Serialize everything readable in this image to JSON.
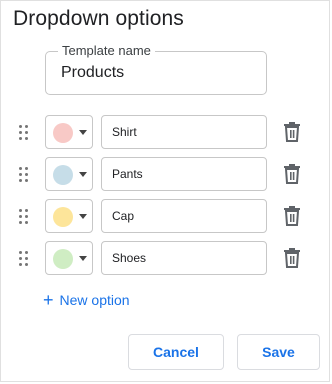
{
  "dialog": {
    "title": "Dropdown options",
    "template_label": "Template name",
    "template_value": "Products"
  },
  "options": [
    {
      "label": "Shirt",
      "color": "#f8c9c6"
    },
    {
      "label": "Pants",
      "color": "#c6dde8"
    },
    {
      "label": "Cap",
      "color": "#fde59a"
    },
    {
      "label": "Shoes",
      "color": "#cfedc3"
    }
  ],
  "actions": {
    "new_option": "New option",
    "cancel": "Cancel",
    "save": "Save"
  },
  "icons": {
    "drag": "drag-handle-icon",
    "caret": "chevron-down-icon",
    "delete": "trash-icon",
    "add": "plus-icon"
  },
  "colors": {
    "accent": "#1a73e8"
  }
}
